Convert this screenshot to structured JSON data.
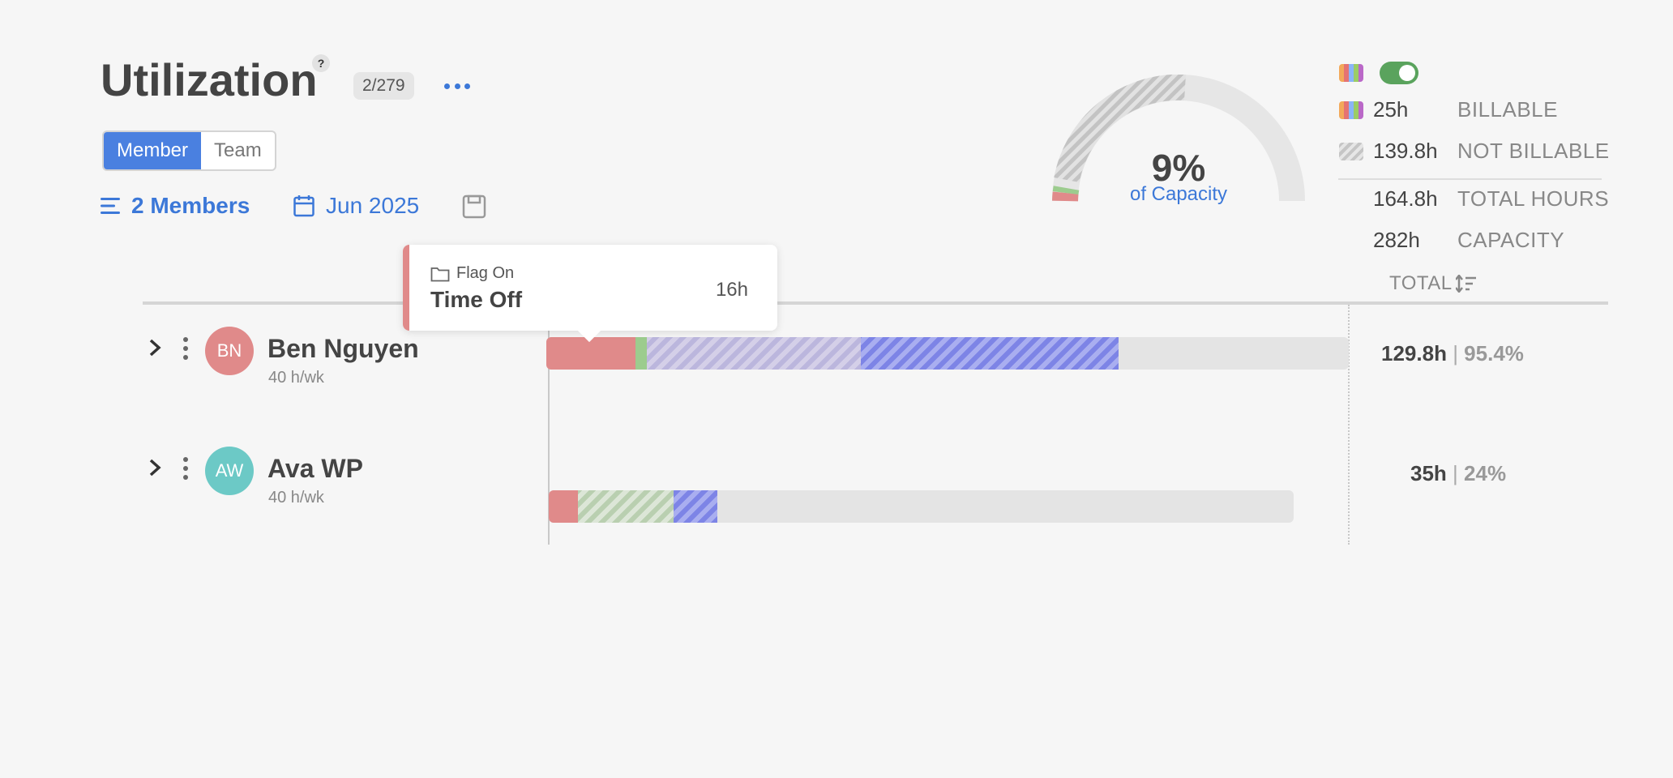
{
  "header": {
    "title": "Utilization",
    "help": "?",
    "count_badge": "2/279",
    "more_icon": "ellipsis-icon"
  },
  "view_toggle": {
    "options": [
      "Member",
      "Team"
    ],
    "selected": "Member"
  },
  "filters": {
    "members_label": "2 Members",
    "date_label": "Jun 2025"
  },
  "gauge": {
    "percent_label": "9%",
    "subtitle": "of Capacity",
    "value_fraction": 0.09
  },
  "legend": {
    "toggle_on": true,
    "items": [
      {
        "value": "25h",
        "label": "BILLABLE",
        "swatch": "rainbow"
      },
      {
        "value": "139.8h",
        "label": "NOT BILLABLE",
        "swatch": "hatch"
      },
      {
        "value": "164.8h",
        "label": "TOTAL HOURS",
        "swatch": ""
      },
      {
        "value": "282h",
        "label": "CAPACITY",
        "swatch": ""
      }
    ],
    "total_column_label": "TOTAL"
  },
  "rows": [
    {
      "initials": "BN",
      "name": "Ben Nguyen",
      "schedule": "40 h/wk",
      "avatar_color": "#e08a8a",
      "total": "129.8h",
      "percent": "95.4%"
    },
    {
      "initials": "AW",
      "name": "Ava WP",
      "schedule": "40 h/wk",
      "avatar_color": "#6cc9c6",
      "total": "35h",
      "percent": "24%"
    }
  ],
  "tooltip": {
    "project": "Flag On",
    "title": "Time Off",
    "hours": "16h"
  },
  "colors": {
    "accent": "#3c78d8",
    "time_off": "#e08a8a",
    "toggle_green": "#5aa35d"
  }
}
